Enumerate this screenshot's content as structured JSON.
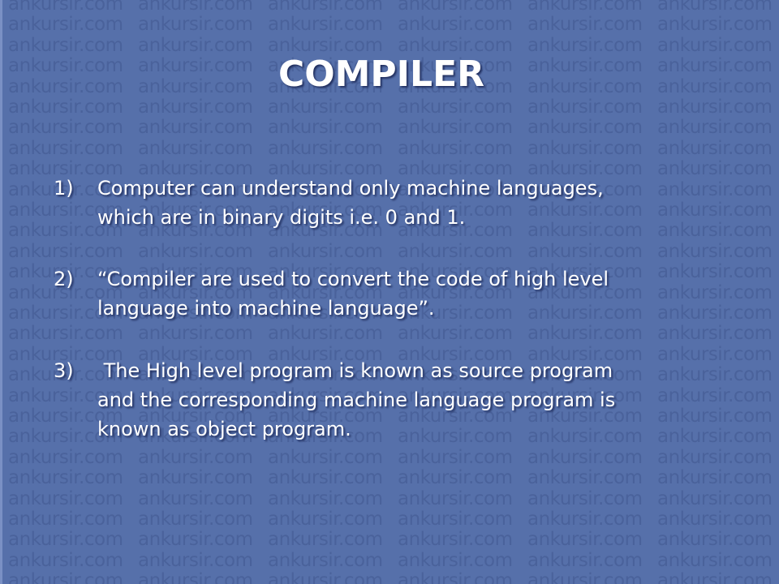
{
  "watermark": "ankursir.com",
  "title": "COMPILER",
  "items": [
    {
      "number": "1)",
      "lines": [
        "Computer can understand only machine languages,",
        "which are in binary digits i.e. 0 and 1."
      ]
    },
    {
      "number": "2)",
      "lines": [
        "“Compiler are used to convert the code of high level",
        "language into machine language”."
      ]
    },
    {
      "number": "3)",
      "lines": [
        " The High level program is known as source program",
        "and the corresponding machine language program is",
        "known as object program."
      ]
    }
  ]
}
